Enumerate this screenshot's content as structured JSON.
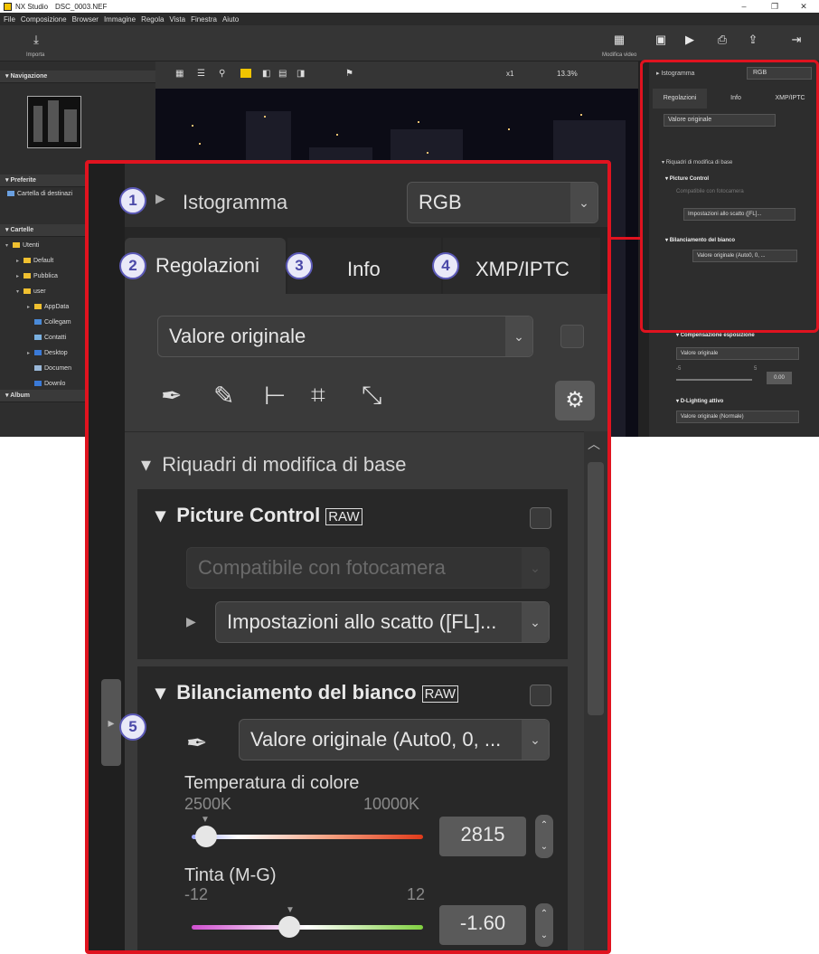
{
  "app": {
    "name": "NX Studio",
    "filename": "DSC_0003.NEF"
  },
  "menu": [
    "File",
    "Composizione",
    "Browser",
    "Immagine",
    "Regola",
    "Vista",
    "Finestra",
    "Aiuto"
  ],
  "toolbar": {
    "import_label": "Importa",
    "video_label": "Modifica video"
  },
  "left": {
    "navigation_title": "Navigazione",
    "favorites_title": "Preferite",
    "favorites_item": "Cartella di destinazi",
    "folders_title": "Cartelle",
    "tree": [
      "Utenti",
      "Default",
      "Pubblica",
      "user",
      "AppData",
      "Collegam",
      "Contatti",
      "Desktop",
      "Documen",
      "Downlo"
    ],
    "album_title": "Album"
  },
  "viewer": {
    "zoom_x": "x1",
    "zoom_pct": "13.3%"
  },
  "panel": {
    "histogram_label": "Istogramma",
    "histogram_channel": "RGB",
    "tabs": [
      "Regolazioni",
      "Info",
      "XMP/IPTC"
    ],
    "preset": "Valore originale",
    "section_title": "Riquadri di modifica di base",
    "picture_control": {
      "title": "Picture Control",
      "raw_badge": "RAW",
      "compat": "Compatibile con fotocamera",
      "setting": "Impostazioni allo scatto ([FL]..."
    },
    "white_balance": {
      "title": "Bilanciamento del bianco",
      "raw_badge": "RAW",
      "value": "Valore originale (Auto0, 0, ...",
      "temp_label": "Temperatura di colore",
      "temp_min": "2500K",
      "temp_max": "10000K",
      "temp_value": "2815",
      "tint_label": "Tinta (M-G)",
      "tint_min": "-12",
      "tint_max": "12",
      "tint_value": "-1.60"
    },
    "small": {
      "setting_short": "Impostazioni allo scatto ([FL]...",
      "wb_value": "Valore originale (Auto0, 0, ...",
      "exposure_title": "Compensazione esposizione",
      "exposure_preset": "Valore originale",
      "exposure_min": "-5",
      "exposure_max": "5",
      "exposure_value": "0.00",
      "dlighting_title": "D-Lighting attivo",
      "dlighting_value": "Valore originale (Normale)"
    }
  },
  "callouts": [
    "1",
    "2",
    "3",
    "4",
    "5"
  ],
  "colors": {
    "accent": "#e0131f",
    "callout": "#5c5ab8"
  }
}
